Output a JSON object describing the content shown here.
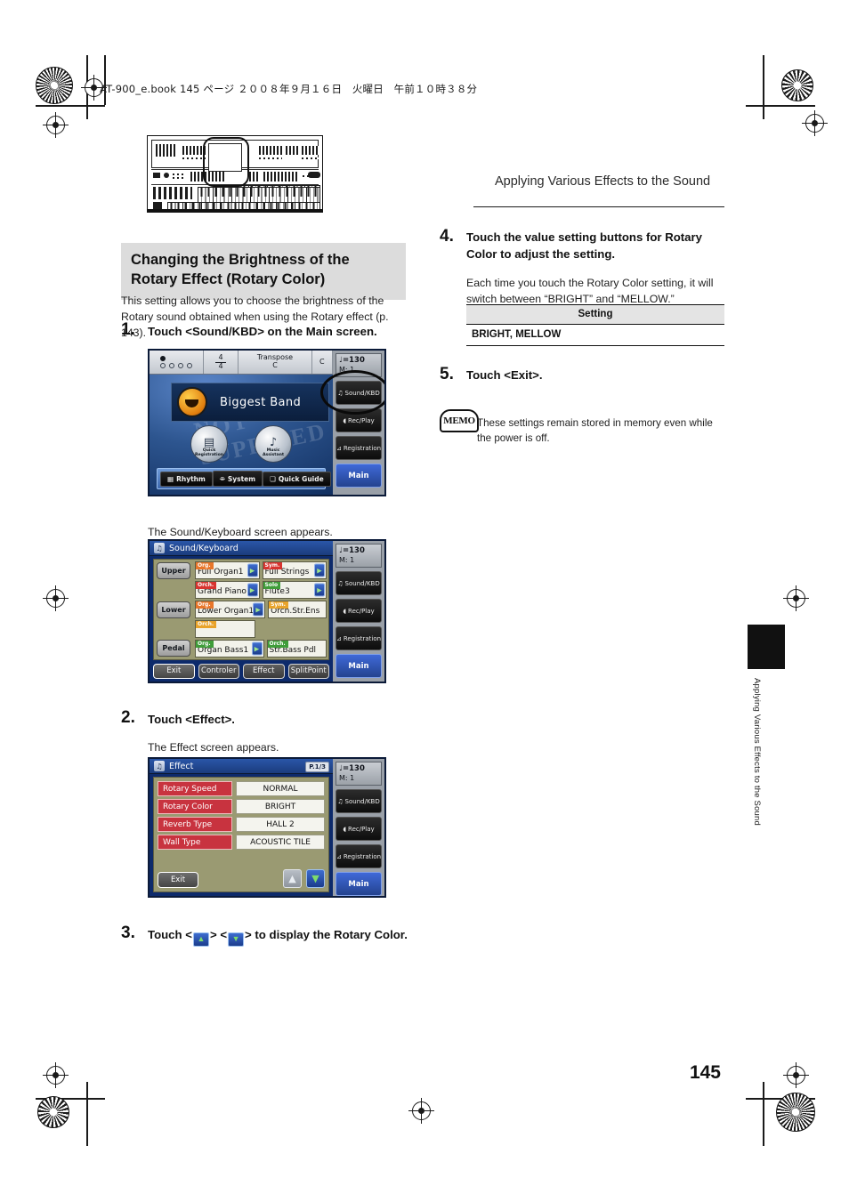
{
  "print": {
    "book_header": "AT-900_e.book  145 ページ  ２００８年９月１６日　火曜日　午前１０時３８分"
  },
  "running_head": "Applying Various Effects to the Sound",
  "section": {
    "title": "Changing the Brightness of the Rotary Effect (Rotary Color)",
    "intro": "This setting allows you to choose the brightness of the Rotary sound obtained when using the Rotary effect (p. 143)."
  },
  "steps": {
    "s1": {
      "num": "1.",
      "head": "Touch <Sound/KBD> on the Main screen.",
      "after": "The Sound/Keyboard screen appears."
    },
    "s2": {
      "num": "2.",
      "head": "Touch <Effect>.",
      "after": "The Effect screen appears."
    },
    "s3": {
      "num": "3.",
      "head_a": "Touch <",
      "head_b": "> <",
      "head_c": "> to display the Rotary Color."
    },
    "s4": {
      "num": "4.",
      "head": "Touch the value setting buttons for Rotary Color to adjust the setting.",
      "body": "Each time you touch the Rotary Color setting, it will switch between “BRIGHT” and “MELLOW.”"
    },
    "s5": {
      "num": "5.",
      "head": "Touch <Exit>."
    }
  },
  "setting_table": {
    "header": "Setting",
    "rows": [
      "BRIGHT, MELLOW"
    ]
  },
  "memo": {
    "badge": "MEMO",
    "text": "These settings remain stored in memory even while the power is off."
  },
  "main_screen": {
    "beat_numerator": "4",
    "beat_denominator": "4",
    "transpose_label": "Transpose",
    "transpose_value": "C",
    "key_value": "C",
    "tempo_line1": "♩=130",
    "tempo_line2": "M:      1",
    "song_title": "Biggest Band",
    "watermark": "NOT SUPPLIED",
    "round_icons": [
      {
        "line1": "Quick",
        "line2": "Registration",
        "glyph": "▤"
      },
      {
        "line1": "Music",
        "line2": "Assistant",
        "glyph": "♪"
      }
    ],
    "bottom_buttons": [
      {
        "label": "Rhythm",
        "glyph": "▦"
      },
      {
        "label": "System",
        "glyph": "⌯"
      },
      {
        "label": "Quick Guide",
        "glyph": "❏"
      }
    ],
    "side_buttons": [
      {
        "label": "Sound/KBD",
        "glyph": "♫"
      },
      {
        "label": "Rec/Play",
        "glyph": "◖"
      },
      {
        "label": "Registration",
        "glyph": "⊿"
      }
    ],
    "main_button": "Main"
  },
  "sound_keyboard_screen": {
    "title": "Sound/Keyboard",
    "tempo_line1": "♩=130",
    "tempo_line2": "M:      1",
    "parts": [
      "Upper",
      "Lower",
      "Pedal"
    ],
    "tone_rows": [
      {
        "left": {
          "cat": "Org.",
          "cat_color": "#e8762a",
          "name": "Full Organ1",
          "arrow": true
        },
        "right": {
          "cat": "Sym.",
          "cat_color": "#d8342f",
          "name": "Full Strings",
          "arrow": true
        }
      },
      {
        "left": {
          "cat": "Orch.",
          "cat_color": "#d8342f",
          "name": "Grand Piano",
          "arrow": true
        },
        "right": {
          "cat": "Solo",
          "cat_color": "#3f9d3a",
          "name": "Flute3",
          "arrow": true
        }
      },
      {
        "left": {
          "cat": "Org.",
          "cat_color": "#e8762a",
          "name": "Lower Organ1",
          "arrow": true
        },
        "right": {
          "cat": "Sym.",
          "cat_color": "#e8a32a",
          "name": "Orch.Str.Ens",
          "arrow": false
        }
      },
      {
        "left": {
          "cat": "Orch.",
          "cat_color": "#e8a32a",
          "name": "",
          "arrow": false
        },
        "right": {
          "cat": "",
          "cat_color": "#e8a32a",
          "name": "",
          "arrow": false
        }
      },
      {
        "left": {
          "cat": "Org.",
          "cat_color": "#3f9d3a",
          "name": "Organ Bass1",
          "arrow": true
        },
        "right": {
          "cat": "Orch.",
          "cat_color": "#3f9d3a",
          "name": "Str.Bass Pdl",
          "arrow": false
        }
      }
    ],
    "bottom_tabs": [
      "Exit",
      "Controler",
      "Effect",
      "SplitPoint"
    ],
    "side_buttons": [
      {
        "label": "Sound/KBD",
        "glyph": "♫"
      },
      {
        "label": "Rec/Play",
        "glyph": "◖"
      },
      {
        "label": "Registration",
        "glyph": "⊿"
      }
    ],
    "main_button": "Main"
  },
  "effect_screen": {
    "title": "Effect",
    "page_chip": "P.1/3",
    "tempo_line1": "♩=130",
    "tempo_line2": "M:      1",
    "rows": [
      {
        "label": "Rotary Speed",
        "value": "NORMAL"
      },
      {
        "label": "Rotary Color",
        "value": "BRIGHT"
      },
      {
        "label": "Reverb Type",
        "value": "HALL 2"
      },
      {
        "label": "Wall Type",
        "value": "ACOUSTIC TILE"
      }
    ],
    "exit_label": "Exit",
    "arrow_up": "▲",
    "arrow_down": "▼",
    "side_buttons": [
      {
        "label": "Sound/KBD",
        "glyph": "♫"
      },
      {
        "label": "Rec/Play",
        "glyph": "◖"
      },
      {
        "label": "Registration",
        "glyph": "⊿"
      }
    ],
    "main_button": "Main"
  },
  "side_tab": {
    "text": "Applying Various Effects to the Sound"
  },
  "page_number": "145"
}
